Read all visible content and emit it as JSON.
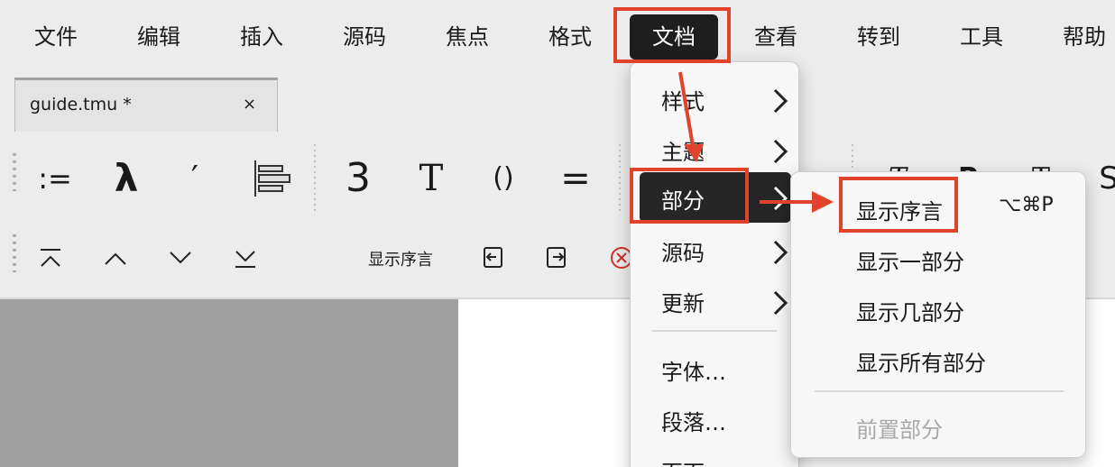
{
  "menubar": {
    "items": [
      "文件",
      "编辑",
      "插入",
      "源码",
      "焦点",
      "格式",
      "文档",
      "查看",
      "转到",
      "工具",
      "帮助"
    ],
    "active": "文档"
  },
  "tab": {
    "title": "guide.tmu *",
    "close": "×"
  },
  "toolbar1": {
    "items": [
      {
        "name": "assign",
        "label": ":="
      },
      {
        "name": "lambda",
        "label": "λ"
      },
      {
        "name": "prime",
        "label": "′"
      },
      {
        "name": "align-icon",
        "label": ""
      },
      {
        "name": "big-3",
        "label": "3"
      },
      {
        "name": "text-t",
        "label": "T"
      },
      {
        "name": "parens",
        "label": "()"
      },
      {
        "name": "equals",
        "label": "="
      }
    ]
  },
  "toolbar2": {
    "show_prologue": "显示序言",
    "icons": [
      "first-section-icon",
      "prev-section-icon",
      "next-section-icon",
      "last-section-icon",
      "import-icon",
      "export-icon",
      "close-circle-icon"
    ]
  },
  "document_menu": {
    "items": [
      "样式",
      "主题",
      "部分",
      "源码",
      "更新"
    ],
    "items_after_divider": [
      "字体…",
      "段落…",
      "页面"
    ],
    "selected": "部分"
  },
  "sections_submenu": {
    "items": [
      "显示序言",
      "显示一部分",
      "显示几部分",
      "显示所有部分"
    ],
    "shortcut": "⌥⌘P",
    "disabled_item": "前置部分"
  },
  "colors": {
    "highlight": "#e0432c",
    "menu_selected": "#262626"
  }
}
